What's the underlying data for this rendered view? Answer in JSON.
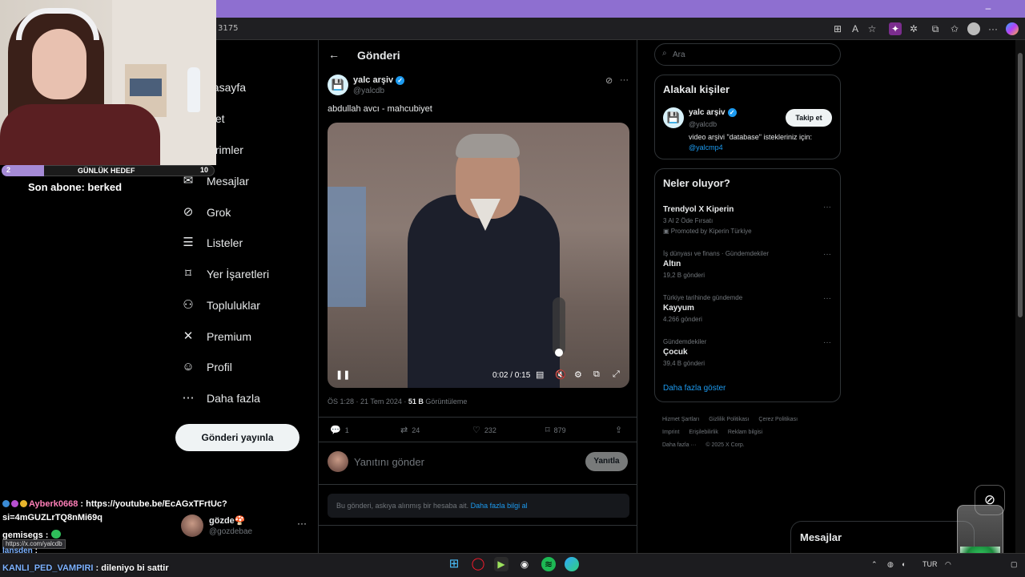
{
  "browser": {
    "url_fragment": "3175",
    "window_controls": [
      "–",
      "❐",
      "✕"
    ]
  },
  "overlay": {
    "goal": {
      "label": "GÜNLÜK HEDEF",
      "current": "2",
      "target": "10",
      "progress": 0.2
    },
    "last_sub": "Son abone: berked",
    "chat": [
      {
        "user": "Ayberk0668",
        "sep": " : ",
        "text": "https://youtube.be/EcAGxTFrtUc?",
        "color": "#ff7fb8"
      },
      {
        "user": "",
        "sep": "",
        "text": "si=4mGUZLrTQ8nMi69q",
        "color": "#ffffff"
      },
      {
        "user": "gemisegs",
        "sep": " : ",
        "text": "",
        "color": "#ffffff"
      },
      {
        "user": "lansden",
        "sep": " : ",
        "text": "",
        "color": "#7db2ff"
      },
      {
        "user": "KANLI_PED_VAMPIRI",
        "sep": " : ",
        "text": "dileniyo bi sattir",
        "color": "#7db2ff"
      }
    ],
    "link_tooltip": "https://x.com/yalcdb"
  },
  "nav": {
    "items": [
      {
        "label": "nasayfa",
        "icon": "home-icon"
      },
      {
        "label": "şfet",
        "icon": "explore-icon"
      },
      {
        "label": "dirimler",
        "icon": "bell-icon"
      },
      {
        "label": "Mesajlar",
        "icon": "envelope-icon"
      },
      {
        "label": "Grok",
        "icon": "grok-icon"
      },
      {
        "label": "Listeler",
        "icon": "list-icon"
      },
      {
        "label": "Yer İşaretleri",
        "icon": "bookmark-icon"
      },
      {
        "label": "Topluluklar",
        "icon": "communities-icon"
      },
      {
        "label": "Premium",
        "icon": "x-logo-icon"
      },
      {
        "label": "Profil",
        "icon": "person-icon"
      },
      {
        "label": "Daha fazla",
        "icon": "more-circle-icon"
      }
    ],
    "post_button": "Gönderi yayınla",
    "account": {
      "name": "gözde🍄",
      "handle": "@gozdebae",
      "more": "···"
    }
  },
  "post": {
    "header_title": "Gönderi",
    "author": {
      "name": "yalc arşiv",
      "handle": "@yalcdb",
      "avatar_icon": "💾"
    },
    "text": "abdullah avcı - mahcubiyet",
    "video": {
      "time": "0:02 / 0:15",
      "volume_level": 0.0
    },
    "meta": {
      "time": "ÖS 1:28 · 21 Tem 2024 · ",
      "views": "51 B",
      "views_label": " Görüntüleme"
    },
    "actions": {
      "replies": "1",
      "reposts": "24",
      "likes": "232",
      "bookmarks": "879"
    },
    "reply_placeholder": "Yanıtını gönder",
    "reply_button": "Yanıtla",
    "notice_text": "Bu gönderi, askıya alınmış bir hesaba ait. ",
    "notice_link": "Daha fazla bilgi al"
  },
  "sidebar": {
    "search_placeholder": "Ara",
    "relevant": {
      "title": "Alakalı kişiler",
      "name": "yalc arşiv",
      "handle": "@yalcdb",
      "follow": "Takip et",
      "bio": "video arşivi \"database\" istekleriniz için:",
      "bio_link": "@yalcmp4"
    },
    "trends": {
      "title": "Neler oluyor?",
      "items": [
        {
          "context": "",
          "name": "Trendyol X Kiperin",
          "count": "3 Al 2 Öde Fırsatı",
          "promo": "Promoted by Kiperin Türkiye"
        },
        {
          "context": "İş dünyası ve finans · Gündemdekiler",
          "name": "Altın",
          "count": "19,2 B gönderi",
          "promo": ""
        },
        {
          "context": "Türkiye tarihinde gündemde",
          "name": "Kayyum",
          "count": "4.266 gönderi",
          "promo": ""
        },
        {
          "context": "Gündemdekiler",
          "name": "Çocuk",
          "count": "39,4 B gönderi",
          "promo": ""
        }
      ],
      "show_more": "Daha fazla göster"
    },
    "footer": [
      "Hizmet Şartları",
      "Gizlilik Politikası",
      "Çerez Politikası",
      "Imprint",
      "Erişilebilirlik",
      "Reklam bilgisi",
      "Daha fazla ···",
      "© 2025 X Corp."
    ],
    "messages_title": "Mesajlar"
  },
  "taskbar": {
    "lang": "TUR"
  }
}
